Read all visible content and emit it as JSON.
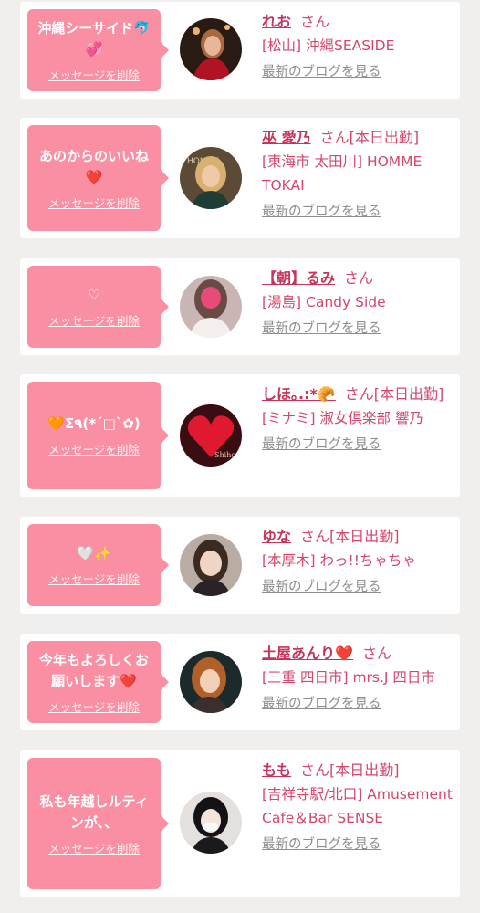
{
  "delete_label": "メッセージを削除",
  "blog_label": "最新のブログを見る",
  "san": "さん",
  "colors": {
    "bubble": "#fa8ea2",
    "name": "#c8335a",
    "link_gray": "#8e8e8e",
    "background": "#f1eeee"
  },
  "items": [
    {
      "message": "沖縄シーサイド🐬💞",
      "name": "れお",
      "status": "",
      "shop": "[松山] 沖縄SEASIDE",
      "avatar_icon": "woman-in-red-dress-photo"
    },
    {
      "message": "あのからのいいね❤️",
      "name": "巫 愛乃",
      "status": "[本日出勤]",
      "shop": "[東海市 太田川] HOMME TOKAI",
      "avatar_icon": "woman-blonde-hair-photo"
    },
    {
      "message": "♡",
      "name": "【朝】るみ",
      "status": "",
      "shop": "[湯島] Candy Side",
      "avatar_icon": "woman-selfie-photo"
    },
    {
      "message": "🧡Σ٩(*´□`✿)",
      "name": "しほ｡.:*🥐",
      "status": "[本日出勤]",
      "shop": "[ミナミ] 淑女倶楽部 響乃",
      "avatar_icon": "red-heart-photo"
    },
    {
      "message": "🤍✨",
      "name": "ゆな",
      "status": "[本日出勤]",
      "shop": "[本厚木] わっ!!ちゃちゃ",
      "avatar_icon": "woman-portrait-photo"
    },
    {
      "message": "今年もよろしくお願いします❤️",
      "name": "土屋あんり❤️",
      "status": "",
      "shop": "[三重 四日市] mrs.J 四日市",
      "avatar_icon": "woman-orange-hair-photo"
    },
    {
      "message": "私も年越しルティンが、、",
      "name": "もも",
      "status": "[本日出勤]",
      "shop": "[吉祥寺駅/北口] Amusement Cafe＆Bar SENSE",
      "avatar_icon": "woman-black-hair-photo"
    }
  ]
}
